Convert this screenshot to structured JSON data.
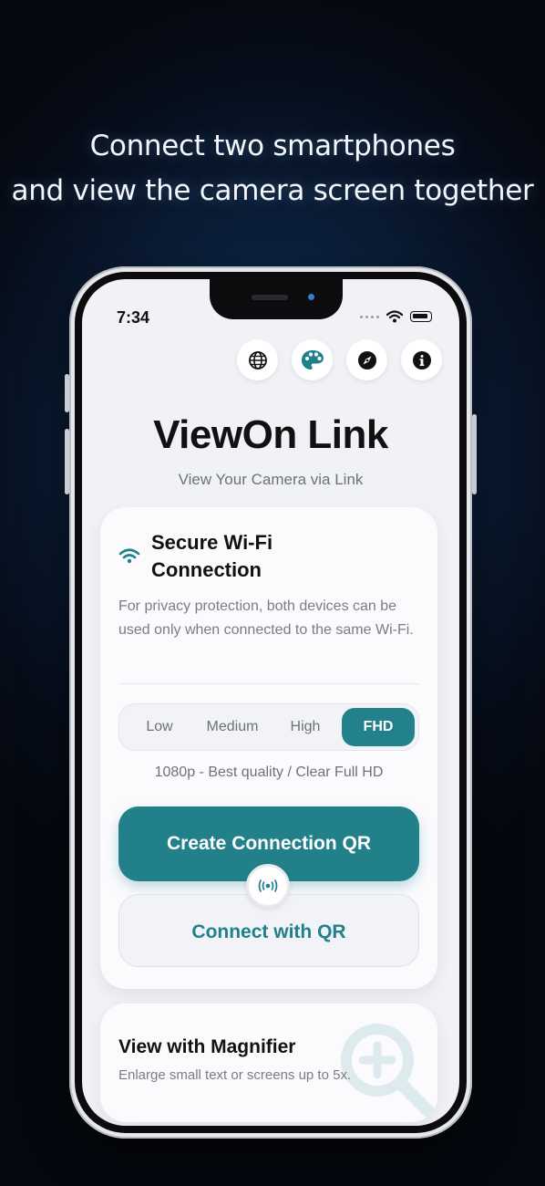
{
  "promo": {
    "line1": "Connect two smartphones",
    "line2": "and view the camera screen together"
  },
  "status_bar": {
    "time": "7:34"
  },
  "toolbar": {
    "icons": [
      "globe-icon",
      "palette-icon",
      "compass-icon",
      "info-icon"
    ]
  },
  "app": {
    "title": "ViewOn Link",
    "subtitle": "View Your Camera via Link"
  },
  "connection_card": {
    "title": "Secure Wi-Fi Connection",
    "description": "For privacy protection, both devices can be used only when connected to the same Wi-Fi.",
    "quality_options": [
      "Low",
      "Medium",
      "High",
      "FHD"
    ],
    "selected_quality": "FHD",
    "quality_caption": "1080p - Best quality / Clear Full HD",
    "create_button": "Create Connection QR",
    "connect_button": "Connect with QR"
  },
  "magnifier_card": {
    "title": "View with Magnifier",
    "description": "Enlarge small text or screens up to 5x."
  },
  "colors": {
    "accent": "#21808a",
    "screen_bg": "#f1f2f6",
    "page_bg": "#0b1f3a"
  }
}
